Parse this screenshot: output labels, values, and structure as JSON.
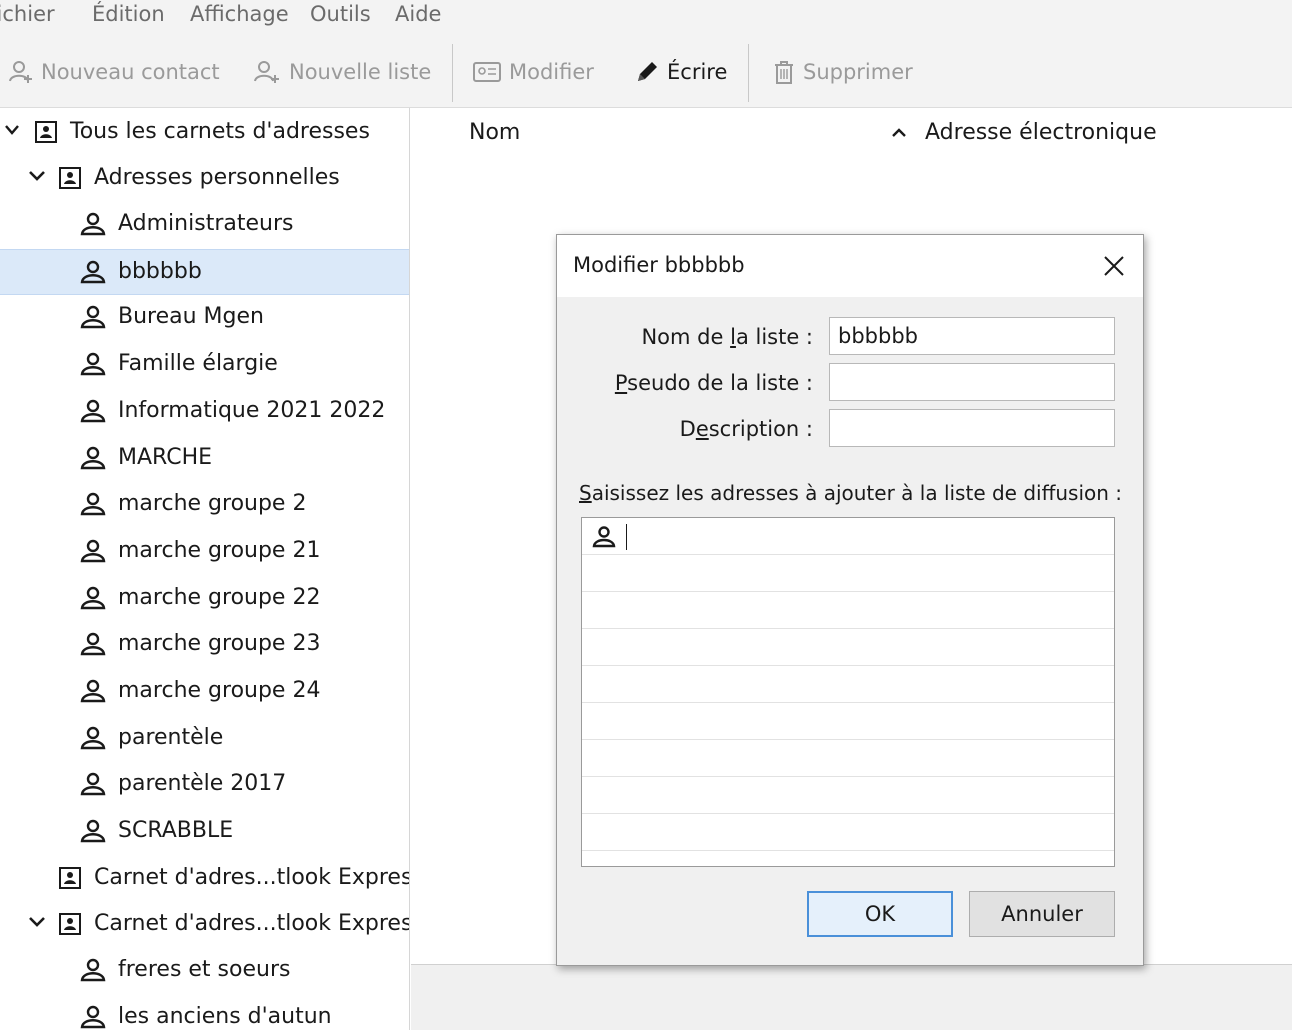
{
  "menubar": {
    "items": [
      "Fichier",
      "Édition",
      "Affichage",
      "Outils",
      "Aide"
    ]
  },
  "toolbar": {
    "new_contact": "Nouveau contact",
    "new_list": "Nouvelle liste",
    "edit": "Modifier",
    "write": "Écrire",
    "delete": "Supprimer"
  },
  "sidebar": {
    "all_books": "Tous les carnets d'adresses",
    "personal": "Adresses personnelles",
    "lists": [
      "Administrateurs",
      "bbbbbb",
      "Bureau Mgen",
      "Famille élargie",
      "Informatique 2021 2022",
      "MARCHE",
      "marche groupe 2",
      "marche groupe 21",
      "marche groupe 22",
      "marche groupe 23",
      "marche groupe 24",
      "parentèle",
      "parentèle 2017",
      "SCRABBLE"
    ],
    "outlook_book_1": "Carnet d'adres...tlook Express",
    "outlook_book_2": "Carnet d'adres...tlook Express",
    "outlook_lists": [
      "freres et soeurs",
      "les anciens d'autun"
    ],
    "selected": "bbbbbb"
  },
  "columns": {
    "name": "Nom",
    "email": "Adresse électronique"
  },
  "dialog": {
    "title": "Modifier bbbbbb",
    "list_name_label_pre": "Nom de ",
    "list_name_label_u": "l",
    "list_name_label_post": "a liste :",
    "list_name_value": "bbbbbb",
    "nickname_label_u": "P",
    "nickname_label_post": "seudo de la liste :",
    "nickname_value": "",
    "description_label_pre": "D",
    "description_label_u": "e",
    "description_label_post": "scription :",
    "description_value": "",
    "addresses_label_u": "S",
    "addresses_label_post": "aisissez les adresses à ajouter à la liste de diffusion :",
    "ok": "OK",
    "cancel": "Annuler"
  }
}
